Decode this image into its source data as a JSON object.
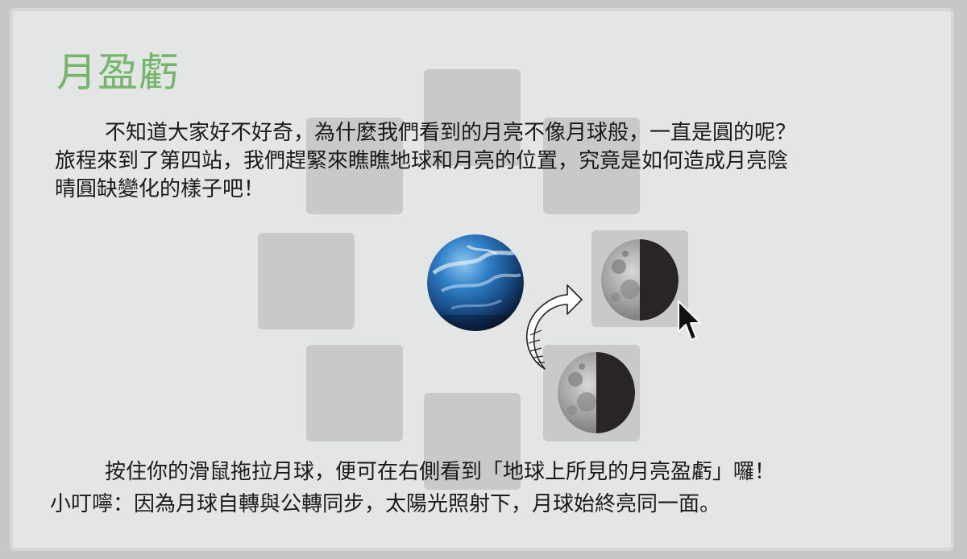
{
  "title": "月盈虧",
  "intro": {
    "line1": "不知道大家好不好奇，為什麼我們看到的月亮不像月球般，一直是圓的呢？",
    "line2": "旅程來到了第四站，我們趕緊來瞧瞧地球和月亮的位置，究竟是如何造成月亮陰",
    "line3": "晴圓缺變化的樣子吧！"
  },
  "instructions": {
    "line1": "按住你的滑鼠拖拉月球，便可在右側看到「地球上所見的月亮盈虧」囉！",
    "line2": "小叮嚀：因為月球自轉與公轉同步，太陽光照射下，月球始終亮同一面。"
  },
  "icons": {
    "earth": "earth-globe-icon",
    "moon_view": "moon-phase-icon",
    "moon_drag": "moon-draggable-icon",
    "arrow": "curved-arrow-icon",
    "cursor": "mouse-pointer-icon"
  },
  "colors": {
    "title": "#74b76a",
    "slot": "#c9c9c9",
    "panel": "#e4e5e5",
    "moon_dark": "#2a2525"
  }
}
